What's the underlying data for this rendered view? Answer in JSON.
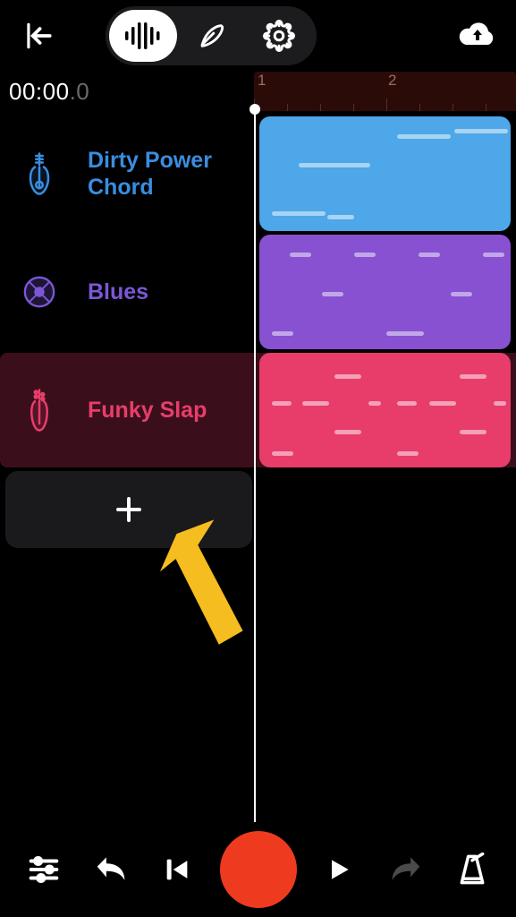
{
  "header": {
    "back": "Back",
    "mode_tracks": "Tracks",
    "mode_lyrics": "Lyrics",
    "mode_settings": "Settings",
    "cloud": "Upload"
  },
  "timecode": {
    "main": "00:00",
    "frac": ".0"
  },
  "ruler": {
    "marks": [
      "1",
      "2"
    ]
  },
  "tracks": [
    {
      "name": "Dirty Power Chord",
      "color": "#4da7e8",
      "icon": "guitar-icon"
    },
    {
      "name": "Blues",
      "color": "#8751d1",
      "icon": "drum-icon"
    },
    {
      "name": "Funky Slap",
      "color": "#e83d6a",
      "icon": "bass-icon"
    }
  ],
  "add_track": {
    "label": "Add Track"
  },
  "transport": {
    "mixer": "Mixer",
    "undo": "Undo",
    "rewind": "Rewind",
    "record": "Record",
    "play": "Play",
    "redo": "Redo",
    "metronome": "Metronome"
  }
}
